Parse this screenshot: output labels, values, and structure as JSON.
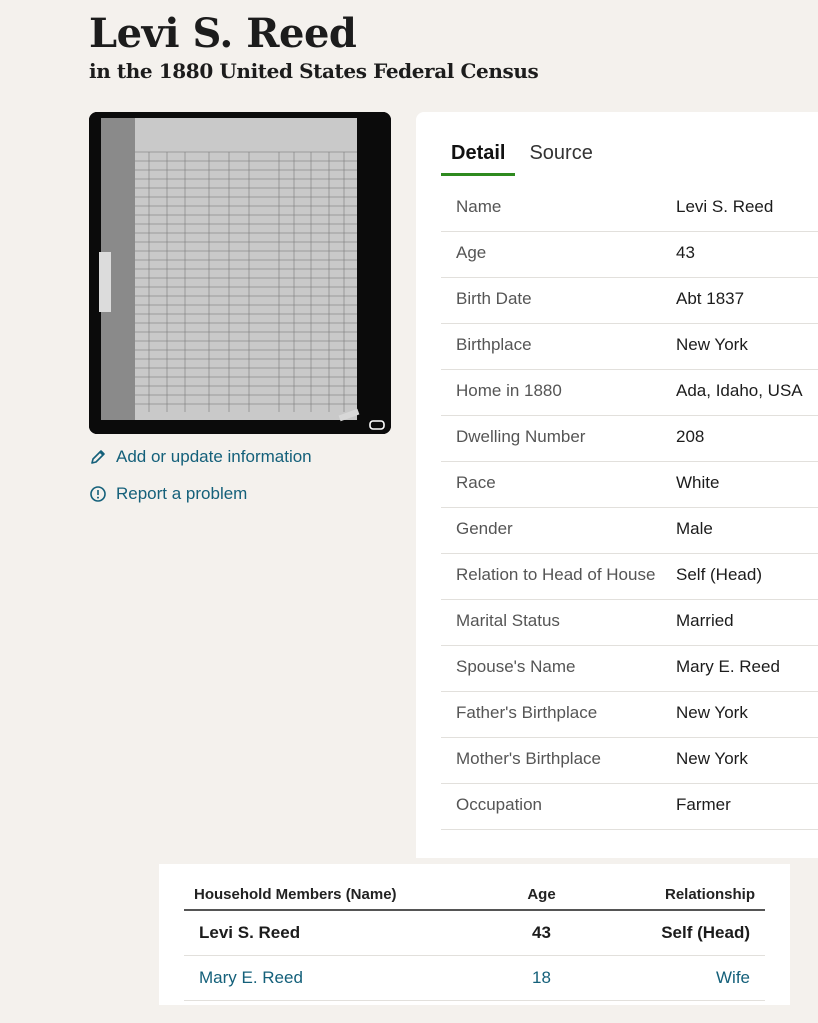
{
  "header": {
    "title": "Levi S. Reed",
    "subtitle": "in the 1880 United States Federal Census"
  },
  "sidebar": {
    "image_alt": "1880 census page scan",
    "add_update_label": "Add or update information",
    "report_problem_label": "Report a problem"
  },
  "tabs": [
    {
      "label": "Detail",
      "active": true
    },
    {
      "label": "Source",
      "active": false
    }
  ],
  "details": [
    {
      "label": "Name",
      "value": "Levi S. Reed"
    },
    {
      "label": "Age",
      "value": "43"
    },
    {
      "label": "Birth Date",
      "value": "Abt 1837"
    },
    {
      "label": "Birthplace",
      "value": "New York"
    },
    {
      "label": "Home in 1880",
      "value": "Ada, Idaho, USA"
    },
    {
      "label": "Dwelling Number",
      "value": "208"
    },
    {
      "label": "Race",
      "value": "White"
    },
    {
      "label": "Gender",
      "value": "Male"
    },
    {
      "label": "Relation to Head of House",
      "value": "Self (Head)"
    },
    {
      "label": "Marital Status",
      "value": "Married"
    },
    {
      "label": "Spouse's Name",
      "value": "Mary E. Reed"
    },
    {
      "label": "Father's Birthplace",
      "value": "New York"
    },
    {
      "label": "Mother's Birthplace",
      "value": "New York"
    },
    {
      "label": "Occupation",
      "value": "Farmer"
    }
  ],
  "household": {
    "headers": {
      "name": "Household Members (Name)",
      "age": "Age",
      "relationship": "Relationship"
    },
    "members": [
      {
        "name": "Levi S. Reed",
        "age": "43",
        "relationship": "Self (Head)"
      },
      {
        "name": "Mary E. Reed",
        "age": "18",
        "relationship": "Wife"
      }
    ]
  },
  "colors": {
    "link": "#14607a",
    "tab_underline": "#2e8a1f",
    "background": "#f4f1ed"
  }
}
